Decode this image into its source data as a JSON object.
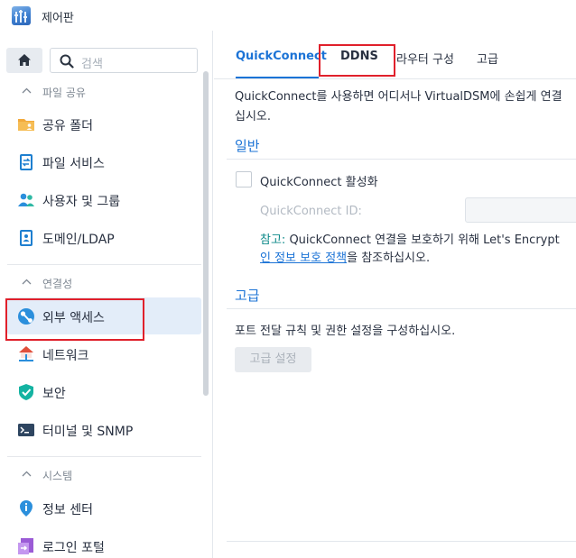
{
  "app": {
    "title": "제어판"
  },
  "sidebar": {
    "search_placeholder": "검색",
    "groups": [
      {
        "label": "파일 공유",
        "items": [
          {
            "label": "공유 폴더",
            "icon": "shared-folder-icon"
          },
          {
            "label": "파일 서비스",
            "icon": "file-services-icon"
          },
          {
            "label": "사용자 및 그룹",
            "icon": "user-group-icon"
          },
          {
            "label": "도메인/LDAP",
            "icon": "domain-ldap-icon"
          }
        ]
      },
      {
        "label": "연결성",
        "items": [
          {
            "label": "외부 액세스",
            "icon": "external-access-icon",
            "active": true
          },
          {
            "label": "네트워크",
            "icon": "network-icon"
          },
          {
            "label": "보안",
            "icon": "security-shield-icon"
          },
          {
            "label": "터미널 및 SNMP",
            "icon": "terminal-icon"
          }
        ]
      },
      {
        "label": "시스템",
        "items": [
          {
            "label": "정보 센터",
            "icon": "info-center-icon"
          },
          {
            "label": "로그인 포털",
            "icon": "login-portal-icon"
          }
        ]
      }
    ]
  },
  "main": {
    "tabs": [
      {
        "label": "QuickConnect",
        "active": true
      },
      {
        "label": "DDNS"
      },
      {
        "label": "라우터 구성"
      },
      {
        "label": "고급"
      }
    ],
    "description_line1": "QuickConnect를 사용하면 어디서나 VirtualDSM에 손쉽게 연결",
    "description_line2": "십시오.",
    "general": {
      "title": "일반",
      "enable_label": "QuickConnect 활성화",
      "id_label": "QuickConnect ID:",
      "id_value": "",
      "note_prefix": "참고:",
      "note_line1": " QuickConnect 연결을 보호하기 위해 Let's Encrypt",
      "note_link": "인 정보 보호 정책",
      "note_line2_suffix": "을 참조하십시오."
    },
    "advanced": {
      "title": "고급",
      "description": "포트 전달 규칙 및 권한 설정을 구성하십시오.",
      "button_label": "고급 설정"
    }
  },
  "colors": {
    "accent": "#1b73d6",
    "highlight": "#e0202b",
    "note": "#0f8a8a"
  }
}
